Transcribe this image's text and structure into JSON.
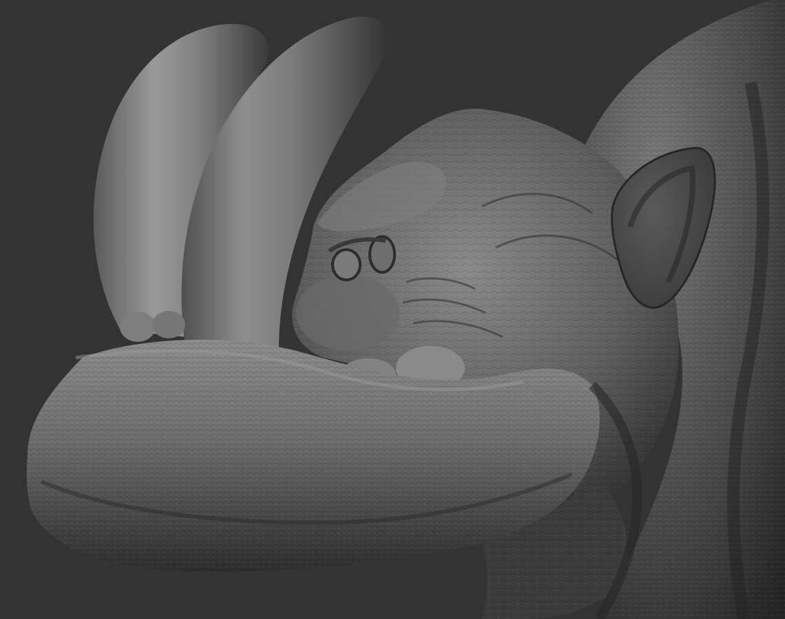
{
  "scene": {
    "background_color": "#333333",
    "material": "clay-gray",
    "subject": "creature-head-sculpt",
    "view": "profile-left"
  }
}
